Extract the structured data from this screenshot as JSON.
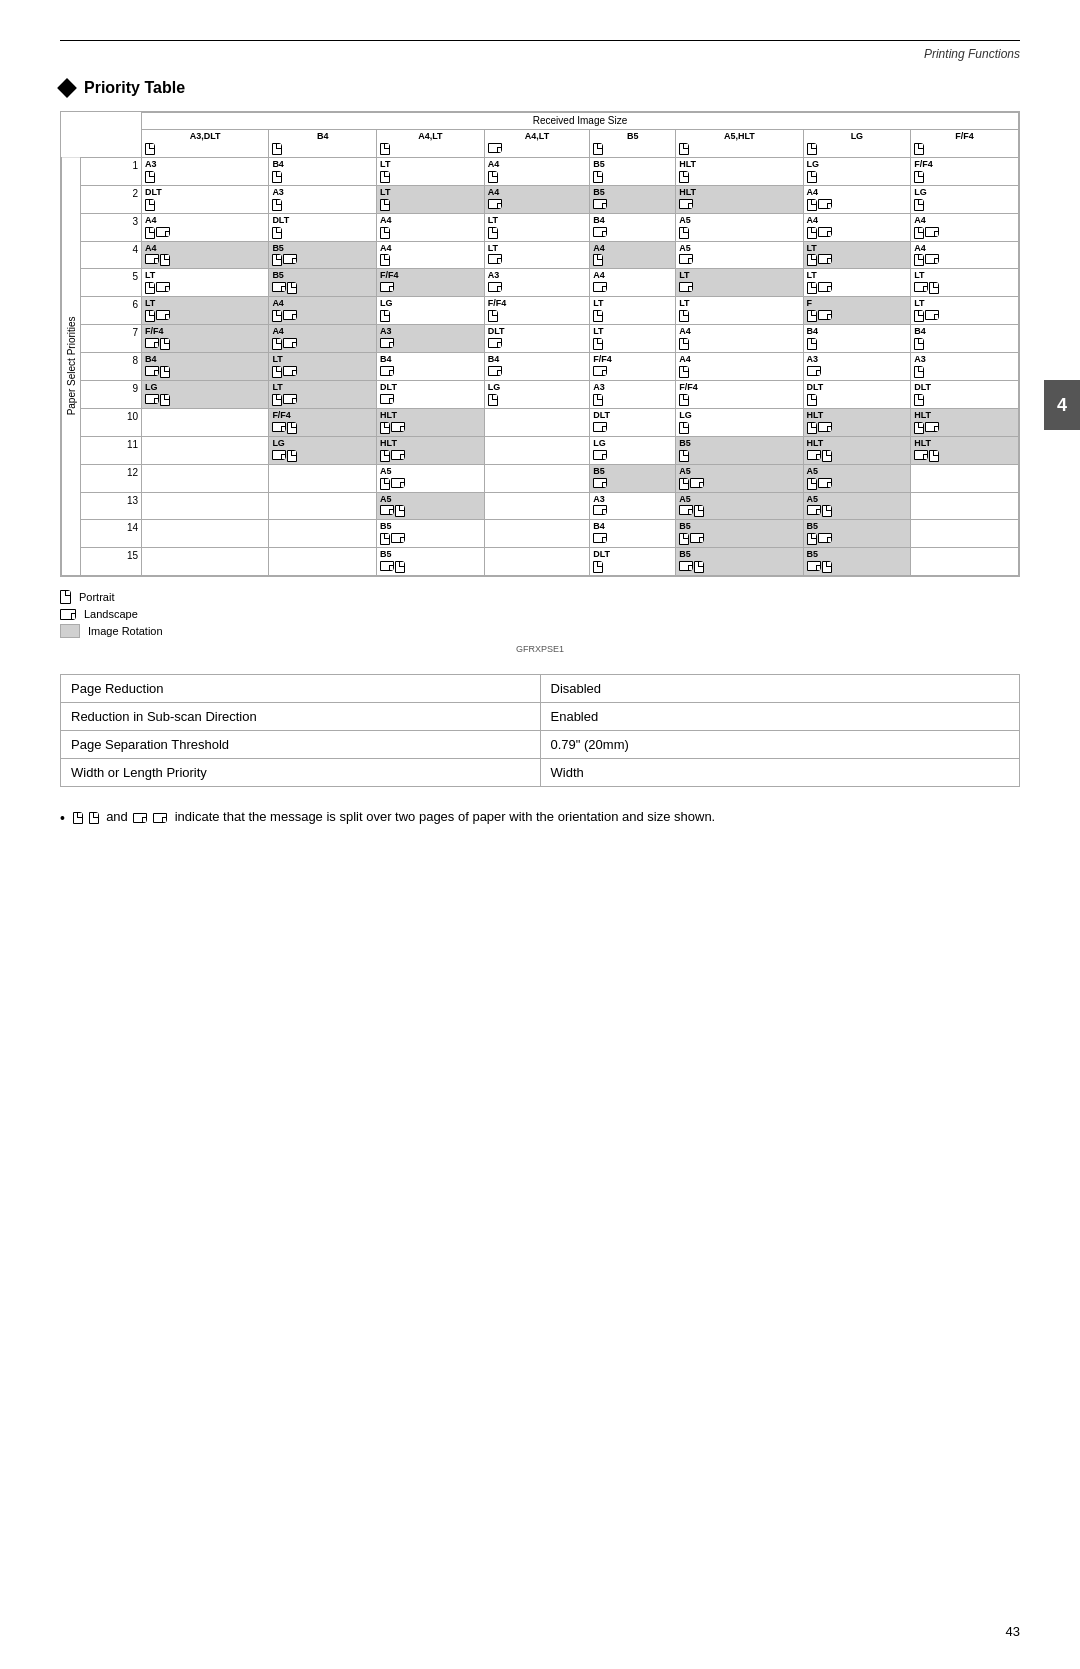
{
  "header": {
    "printing_functions": "Printing Functions"
  },
  "section": {
    "title": "Priority Table"
  },
  "table": {
    "received_image_size": "Received Image Size",
    "paper_select_priorities": "Paper Select Priorities",
    "columns": [
      "A3,DLT",
      "B4",
      "A4,LT",
      "A4,LT",
      "B5",
      "A5,HLT",
      "LG",
      "F/F4"
    ],
    "rows": [
      {
        "num": "1",
        "cells": [
          "A3",
          "B4",
          "LT",
          "A4",
          "B5",
          "HLT",
          "LG",
          "F/F4"
        ]
      },
      {
        "num": "2",
        "cells": [
          "DLT",
          "A3",
          "LT",
          "A4",
          "B5",
          "HLT",
          "A4",
          "LG"
        ],
        "shaded": [
          5
        ]
      },
      {
        "num": "3",
        "cells": [
          "A4",
          "DLT",
          "A4",
          "LT",
          "B4",
          "A5",
          "A4",
          "A4"
        ]
      },
      {
        "num": "4",
        "cells": [
          "A4",
          "B5",
          "A4",
          "LT",
          "A4",
          "A5",
          "LT",
          "A4"
        ],
        "shaded": [
          0,
          1,
          4,
          6
        ]
      },
      {
        "num": "5",
        "cells": [
          "LT",
          "B5",
          "F/F4",
          "A3",
          "A4",
          "LT",
          "LT",
          "LT"
        ],
        "shaded": [
          1,
          2,
          5
        ]
      },
      {
        "num": "6",
        "cells": [
          "LT",
          "A4",
          "LG",
          "F/F4",
          "LT",
          "LT",
          "F",
          "LT"
        ],
        "shaded": [
          0,
          1,
          6
        ]
      },
      {
        "num": "7",
        "cells": [
          "F/F4",
          "A4",
          "A3",
          "DLT",
          "LT",
          "A4",
          "B4",
          "B4"
        ],
        "shaded": [
          0,
          1,
          2
        ]
      },
      {
        "num": "8",
        "cells": [
          "B4",
          "LT",
          "B4",
          "B4",
          "F/F4",
          "A4",
          "A3",
          "A3"
        ],
        "shaded": [
          0,
          1
        ]
      },
      {
        "num": "9",
        "cells": [
          "LG",
          "LT",
          "DLT",
          "LG",
          "A3",
          "F/F4",
          "DLT",
          "DLT"
        ],
        "shaded": [
          0,
          1
        ]
      },
      {
        "num": "10",
        "cells": [
          "",
          "F/F4",
          "HLT",
          "",
          "DLT",
          "LG",
          "HLT",
          "HLT"
        ],
        "shaded": [
          1,
          2,
          6,
          7
        ]
      },
      {
        "num": "11",
        "cells": [
          "",
          "LG",
          "HLT",
          "",
          "LG",
          "B5",
          "HLT",
          "HLT"
        ],
        "shaded": [
          1,
          2,
          5,
          6,
          7
        ]
      },
      {
        "num": "12",
        "cells": [
          "",
          "",
          "A5",
          "",
          "B5",
          "A5",
          "A5",
          ""
        ],
        "shaded": [
          4,
          5,
          6
        ]
      },
      {
        "num": "13",
        "cells": [
          "",
          "",
          "A5",
          "",
          "A3",
          "A5",
          "A5",
          ""
        ],
        "shaded": [
          2,
          4,
          5,
          6
        ]
      },
      {
        "num": "14",
        "cells": [
          "",
          "",
          "B5",
          "",
          "B4",
          "B5",
          "B5",
          ""
        ],
        "shaded": [
          2,
          5,
          6
        ]
      },
      {
        "num": "15",
        "cells": [
          "",
          "",
          "B5",
          "",
          "DLT",
          "B5",
          "B5",
          ""
        ],
        "shaded": [
          2,
          5,
          6
        ]
      }
    ]
  },
  "legend": {
    "portrait_label": "Portrait",
    "landscape_label": "Landscape",
    "rotation_label": "Image Rotation"
  },
  "code": "GFRXPSE1",
  "settings": [
    {
      "label": "Page Reduction",
      "value": "Disabled"
    },
    {
      "label": "Reduction in Sub-scan Direction",
      "value": "Enabled"
    },
    {
      "label": "Page Separation Threshold",
      "value": "0.79\" (20mm)"
    },
    {
      "label": "Width or Length Priority",
      "value": "Width"
    }
  ],
  "note": {
    "symbol": "•",
    "text": " and  indicate that the message is split over two pages of paper with the orientation and size shown."
  },
  "page_number": "43",
  "chapter_number": "4"
}
